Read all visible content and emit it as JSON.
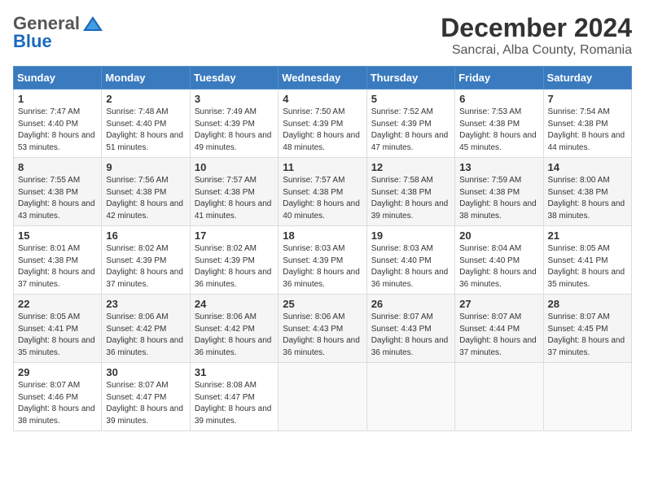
{
  "logo": {
    "general": "General",
    "blue": "Blue"
  },
  "title": "December 2024",
  "subtitle": "Sancrai, Alba County, Romania",
  "days_of_week": [
    "Sunday",
    "Monday",
    "Tuesday",
    "Wednesday",
    "Thursday",
    "Friday",
    "Saturday"
  ],
  "weeks": [
    [
      {
        "day": "1",
        "sunrise": "7:47 AM",
        "sunset": "4:40 PM",
        "daylight": "8 hours and 53 minutes."
      },
      {
        "day": "2",
        "sunrise": "7:48 AM",
        "sunset": "4:40 PM",
        "daylight": "8 hours and 51 minutes."
      },
      {
        "day": "3",
        "sunrise": "7:49 AM",
        "sunset": "4:39 PM",
        "daylight": "8 hours and 49 minutes."
      },
      {
        "day": "4",
        "sunrise": "7:50 AM",
        "sunset": "4:39 PM",
        "daylight": "8 hours and 48 minutes."
      },
      {
        "day": "5",
        "sunrise": "7:52 AM",
        "sunset": "4:39 PM",
        "daylight": "8 hours and 47 minutes."
      },
      {
        "day": "6",
        "sunrise": "7:53 AM",
        "sunset": "4:38 PM",
        "daylight": "8 hours and 45 minutes."
      },
      {
        "day": "7",
        "sunrise": "7:54 AM",
        "sunset": "4:38 PM",
        "daylight": "8 hours and 44 minutes."
      }
    ],
    [
      {
        "day": "8",
        "sunrise": "7:55 AM",
        "sunset": "4:38 PM",
        "daylight": "8 hours and 43 minutes."
      },
      {
        "day": "9",
        "sunrise": "7:56 AM",
        "sunset": "4:38 PM",
        "daylight": "8 hours and 42 minutes."
      },
      {
        "day": "10",
        "sunrise": "7:57 AM",
        "sunset": "4:38 PM",
        "daylight": "8 hours and 41 minutes."
      },
      {
        "day": "11",
        "sunrise": "7:57 AM",
        "sunset": "4:38 PM",
        "daylight": "8 hours and 40 minutes."
      },
      {
        "day": "12",
        "sunrise": "7:58 AM",
        "sunset": "4:38 PM",
        "daylight": "8 hours and 39 minutes."
      },
      {
        "day": "13",
        "sunrise": "7:59 AM",
        "sunset": "4:38 PM",
        "daylight": "8 hours and 38 minutes."
      },
      {
        "day": "14",
        "sunrise": "8:00 AM",
        "sunset": "4:38 PM",
        "daylight": "8 hours and 38 minutes."
      }
    ],
    [
      {
        "day": "15",
        "sunrise": "8:01 AM",
        "sunset": "4:38 PM",
        "daylight": "8 hours and 37 minutes."
      },
      {
        "day": "16",
        "sunrise": "8:02 AM",
        "sunset": "4:39 PM",
        "daylight": "8 hours and 37 minutes."
      },
      {
        "day": "17",
        "sunrise": "8:02 AM",
        "sunset": "4:39 PM",
        "daylight": "8 hours and 36 minutes."
      },
      {
        "day": "18",
        "sunrise": "8:03 AM",
        "sunset": "4:39 PM",
        "daylight": "8 hours and 36 minutes."
      },
      {
        "day": "19",
        "sunrise": "8:03 AM",
        "sunset": "4:40 PM",
        "daylight": "8 hours and 36 minutes."
      },
      {
        "day": "20",
        "sunrise": "8:04 AM",
        "sunset": "4:40 PM",
        "daylight": "8 hours and 36 minutes."
      },
      {
        "day": "21",
        "sunrise": "8:05 AM",
        "sunset": "4:41 PM",
        "daylight": "8 hours and 35 minutes."
      }
    ],
    [
      {
        "day": "22",
        "sunrise": "8:05 AM",
        "sunset": "4:41 PM",
        "daylight": "8 hours and 35 minutes."
      },
      {
        "day": "23",
        "sunrise": "8:06 AM",
        "sunset": "4:42 PM",
        "daylight": "8 hours and 36 minutes."
      },
      {
        "day": "24",
        "sunrise": "8:06 AM",
        "sunset": "4:42 PM",
        "daylight": "8 hours and 36 minutes."
      },
      {
        "day": "25",
        "sunrise": "8:06 AM",
        "sunset": "4:43 PM",
        "daylight": "8 hours and 36 minutes."
      },
      {
        "day": "26",
        "sunrise": "8:07 AM",
        "sunset": "4:43 PM",
        "daylight": "8 hours and 36 minutes."
      },
      {
        "day": "27",
        "sunrise": "8:07 AM",
        "sunset": "4:44 PM",
        "daylight": "8 hours and 37 minutes."
      },
      {
        "day": "28",
        "sunrise": "8:07 AM",
        "sunset": "4:45 PM",
        "daylight": "8 hours and 37 minutes."
      }
    ],
    [
      {
        "day": "29",
        "sunrise": "8:07 AM",
        "sunset": "4:46 PM",
        "daylight": "8 hours and 38 minutes."
      },
      {
        "day": "30",
        "sunrise": "8:07 AM",
        "sunset": "4:47 PM",
        "daylight": "8 hours and 39 minutes."
      },
      {
        "day": "31",
        "sunrise": "8:08 AM",
        "sunset": "4:47 PM",
        "daylight": "8 hours and 39 minutes."
      },
      null,
      null,
      null,
      null
    ]
  ]
}
